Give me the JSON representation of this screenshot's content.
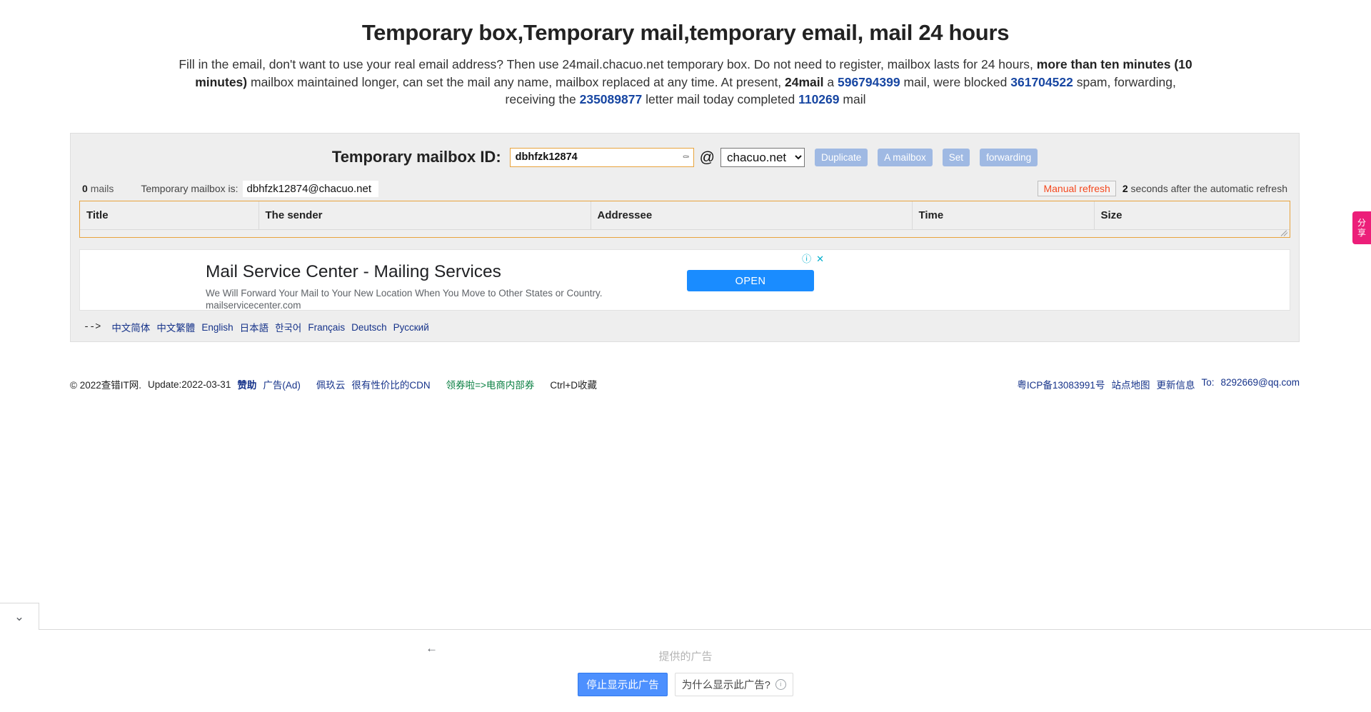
{
  "header": {
    "title": "Temporary box,Temporary mail,temporary email, mail 24 hours",
    "intro": {
      "part1": "Fill in the email, don't want to use your real email address? Then use 24mail.chacuo.net temporary box. Do not need to register, mailbox lasts for 24 hours, ",
      "bold1": "more than ten minutes (10 minutes)",
      "part2": " mailbox maintained longer, can set the mail any name, mailbox replaced at any time. At present, ",
      "bold2": "24mail",
      "part3": " a ",
      "num1": "596794399",
      "part4": " mail, were blocked ",
      "num2": "361704522",
      "part5": " spam, forwarding, receiving the ",
      "num3": "235089877",
      "part6": " letter mail today completed ",
      "num4": "110269",
      "part7": " mail"
    }
  },
  "mailbox": {
    "label": "Temporary mailbox ID:",
    "id_value": "dbhfzk12874",
    "id_placeholder": "",
    "key_icon": "key-icon",
    "at_symbol": "@",
    "domain_selected": "chacuo.net",
    "domain_options": [
      "chacuo.net"
    ],
    "buttons": {
      "duplicate": "Duplicate",
      "a_mailbox": "A mailbox",
      "set": "Set",
      "forwarding": "forwarding"
    }
  },
  "status": {
    "mail_count": "0",
    "mails_word": "mails",
    "temp_label": "Temporary mailbox is:",
    "address": "dbhfzk12874@chacuo.net",
    "manual_refresh": "Manual refresh",
    "refresh_seconds": "2",
    "refresh_note": "seconds after the automatic refresh"
  },
  "table": {
    "columns": [
      "Title",
      "The sender",
      "Addressee",
      "Time",
      "Size"
    ],
    "rows": []
  },
  "ad": {
    "title": "Mail Service Center - Mailing Services",
    "description": "We Will Forward Your Mail to Your New Location When You Move to Other States or Country.",
    "url": "mailservicecenter.com",
    "open_button": "OPEN",
    "info_icon": "info-icon",
    "close_icon": "close-icon"
  },
  "languages": {
    "arrow": "-->",
    "items": [
      "中文简体",
      "中文繁體",
      "English",
      "日本語",
      "한국어",
      "Français",
      "Deutsch",
      "Русский"
    ]
  },
  "footer": {
    "copyright": "© 2022查错IT网.",
    "update": "Update:2022-03-31",
    "sponsor": "赞助",
    "ad_link": "广告(Ad)",
    "peijiu": "佩玖云",
    "cdn": "很有性价比的CDN",
    "coupon": "领券啦=>电商内部券",
    "bookmark": "Ctrl+D收藏",
    "icp": "粤ICP备13083991号",
    "sitemap": "站点地图",
    "update_info": "更新信息",
    "to_label": "To:",
    "email": "8292669@qq.com"
  },
  "share_tab": {
    "text": "分享"
  },
  "bottom_bar": {
    "collapse_icon": "chevron-down-icon",
    "back_icon": "back-arrow-icon",
    "provided_label": "提供的广告",
    "stop_ad": "停止显示此广告",
    "why_ad": "为什么显示此广告?",
    "info_icon": "info-icon"
  },
  "colors": {
    "accent_orange": "#e8a33d",
    "button_blue": "#9fb9e3",
    "link_blue": "#16338a",
    "refresh_red": "#f4481e",
    "ad_blue": "#1a8cff",
    "share_pink": "#ec1e79"
  }
}
